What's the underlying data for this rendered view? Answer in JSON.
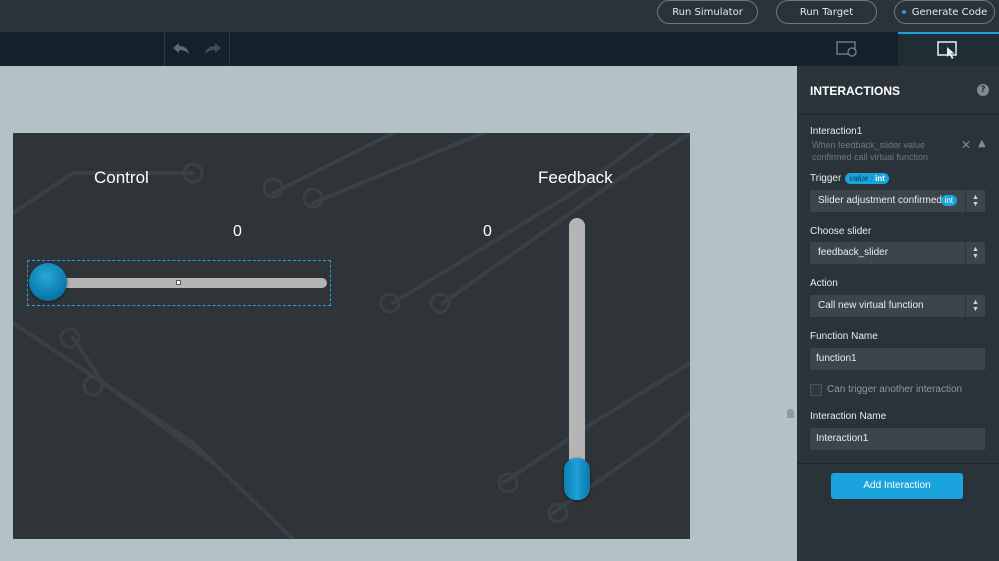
{
  "topbar": {
    "run_simulator": "Run Simulator",
    "run_target": "Run Target",
    "generate_code": "Generate Code"
  },
  "canvas": {
    "control_label": "Control",
    "feedback_label": "Feedback",
    "control_value": "0",
    "feedback_value": "0",
    "control_slider_position": 0,
    "feedback_slider_position": 0
  },
  "panel": {
    "title": "INTERACTIONS",
    "help": "?",
    "interaction": {
      "name": "Interaction1",
      "description": "When feedback_slider value confirmed call virtual function"
    },
    "trigger": {
      "label": "Trigger",
      "badge_value": "value",
      "badge_colon": " : ",
      "badge_type": "int",
      "selected": "Slider adjustment confirmed",
      "selected_badge": "int"
    },
    "choose_slider": {
      "label": "Choose slider",
      "selected": "feedback_slider"
    },
    "action": {
      "label": "Action",
      "selected": "Call new virtual function"
    },
    "function_name": {
      "label": "Function Name",
      "value": "function1"
    },
    "can_trigger": {
      "label": "Can trigger another interaction",
      "checked": false
    },
    "interaction_name": {
      "label": "Interaction Name",
      "value": "Interaction1"
    },
    "add_button": "Add Interaction"
  },
  "colors": {
    "accent": "#1aa3dd",
    "panel_bg": "#2a3339",
    "canvas_bg": "#2e3438",
    "workspace_bg": "#b4c2c8"
  }
}
